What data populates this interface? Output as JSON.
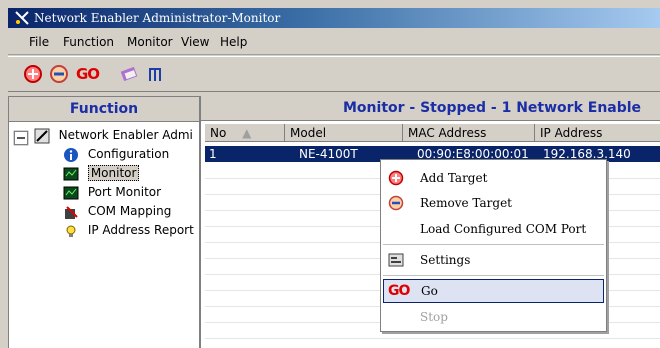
{
  "window": {
    "title": "Network Enabler Administrator-Monitor"
  },
  "menubar": {
    "items": [
      "File",
      "Function",
      "Monitor",
      "View",
      "Help"
    ]
  },
  "toolbar": {
    "buttons": [
      "add-target-icon",
      "remove-target-icon",
      "go-icon",
      "settings-icon",
      "stop-icon"
    ],
    "go_label": "GO"
  },
  "left_panel": {
    "header": "Function",
    "tree": {
      "root": "Network Enabler Admi",
      "children": [
        "Configuration",
        "Monitor",
        "Port Monitor",
        "COM Mapping",
        "IP Address Report"
      ],
      "selected": "Monitor"
    }
  },
  "right_panel": {
    "header": "Monitor - Stopped - 1 Network Enable",
    "columns": [
      "No",
      "Model",
      "MAC Address",
      "IP Address"
    ],
    "rows": [
      {
        "no": "1",
        "model": "NE-4100T",
        "mac": "00:90:E8:00:00:01",
        "ip": "192.168.3.140"
      }
    ]
  },
  "context_menu": {
    "items": [
      {
        "label": "Add Target",
        "icon": "add-target-icon"
      },
      {
        "label": "Remove Target",
        "icon": "remove-target-icon"
      },
      {
        "label": "Load Configured COM Port",
        "icon": ""
      },
      {
        "label": "Settings",
        "icon": "settings-icon"
      },
      {
        "label": "Go",
        "icon": "go-icon",
        "highlighted": true
      },
      {
        "label": "Stop",
        "icon": "",
        "disabled": true
      }
    ]
  },
  "colors": {
    "accent": "#1c2ea6",
    "selection": "#0a246a",
    "go": "#e00000"
  }
}
